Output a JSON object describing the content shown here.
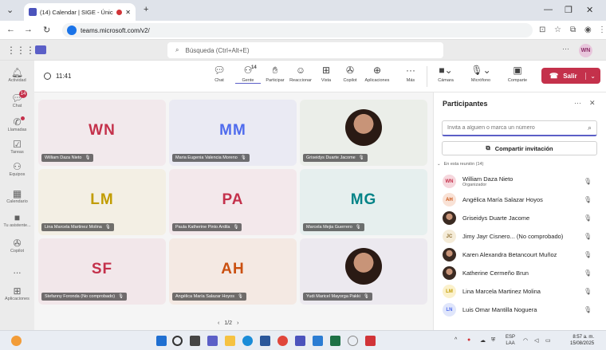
{
  "browser": {
    "tab_title": "(14) Calendar | SIGE - Únic...",
    "url": "teams.microsoft.com/v2/"
  },
  "teams": {
    "search_placeholder": "Búsqueda (Ctrl+Alt+E)",
    "me_initials": "WN"
  },
  "rail": [
    {
      "label": "Actividad",
      "icon": "bell-icon"
    },
    {
      "label": "Chat",
      "icon": "chat-icon",
      "badge": "14"
    },
    {
      "label": "Llamadas",
      "icon": "phone-icon"
    },
    {
      "label": "Tareas",
      "icon": "tasks-icon"
    },
    {
      "label": "Equipos",
      "icon": "teams-icon"
    },
    {
      "label": "Calendario",
      "icon": "calendar-icon"
    },
    {
      "label": "Tu asistente...",
      "icon": "assistant-icon"
    },
    {
      "label": "Copilot",
      "icon": "copilot-icon"
    },
    {
      "label": "...",
      "icon": "more-icon"
    },
    {
      "label": "Aplicaciones",
      "icon": "apps-icon"
    }
  ],
  "meeting": {
    "timer": "11:41",
    "people_count": "14",
    "toolbar": {
      "chat": "Chat",
      "people": "Gente",
      "raise": "Participar",
      "react": "Reaccionar",
      "view": "Vista",
      "copilot": "Copilot",
      "apps": "Aplicaciones",
      "more": "Más",
      "camera": "Cámara",
      "mic": "Micrófono",
      "share": "Comparte",
      "leave": "Salir"
    }
  },
  "tiles": [
    {
      "initials": "WN",
      "name": "William Daza Nieto",
      "color": "#c4314b",
      "bg": "#f2e9ec"
    },
    {
      "initials": "MM",
      "name": "Maria Eugenia Valencia Moreno",
      "color": "#4f6bed",
      "bg": "#eaeaf3"
    },
    {
      "initials": "",
      "name": "Griseidys Duarte Jacome",
      "color": "#000000",
      "bg": "#ebeee9"
    },
    {
      "initials": "LM",
      "name": "Lina Marcela Martinez Molina",
      "color": "#c19c00",
      "bg": "#f3efe4"
    },
    {
      "initials": "PA",
      "name": "Paula Katherine Pinto Ardila",
      "color": "#c4314b",
      "bg": "#f3e8eb"
    },
    {
      "initials": "MG",
      "name": "Marcela Mejia Guerrero",
      "color": "#038387",
      "bg": "#e6efee"
    },
    {
      "initials": "SF",
      "name": "Stefanny Foronda (No comprobado)",
      "color": "#c4314b",
      "bg": "#f2e7ea"
    },
    {
      "initials": "AH",
      "name": "Angélica María Salazar Hoyos",
      "color": "#ca5010",
      "bg": "#f4e9e3"
    },
    {
      "initials": "",
      "name": "Yudi Maricel Mayorga Pakki",
      "color": "#000000",
      "bg": "#ece9ef"
    }
  ],
  "pager": {
    "label": "1/2"
  },
  "panel": {
    "title": "Participantes",
    "invite_placeholder": "Invita a alguien o marca un número",
    "share_invite": "Compartir invitación",
    "section": "En esta reunión (14)",
    "people": [
      {
        "initials": "WN",
        "name": "William Daza Nieto",
        "role": "Organizador",
        "avatar_color": "#c4314b",
        "avatar_bg": "#f6d7dd"
      },
      {
        "initials": "AH",
        "name": "Angélica María Salazar Hoyos",
        "role": "",
        "avatar_color": "#ca5010",
        "avatar_bg": "#f9e2d6"
      },
      {
        "initials": "",
        "name": "Griseidys Duarte Jacome",
        "role": "",
        "avatar_color": "#000000",
        "avatar_bg": "#888888",
        "photo": true
      },
      {
        "initials": "JC",
        "name": "Jimy Jayr Cisnero... (No comprobado)",
        "role": "",
        "avatar_color": "#8f7034",
        "avatar_bg": "#f5ecd8"
      },
      {
        "initials": "",
        "name": "Karen Alexandra Betancourt Muñoz",
        "role": "",
        "avatar_color": "#000000",
        "avatar_bg": "#888888",
        "photo": true
      },
      {
        "initials": "",
        "name": "Katherine Cermeño Brun",
        "role": "",
        "avatar_color": "#000000",
        "avatar_bg": "#888888",
        "photo": true
      },
      {
        "initials": "LM",
        "name": "Lina Marcela Martinez Molina",
        "role": "",
        "avatar_color": "#c19c00",
        "avatar_bg": "#fbf1cc"
      },
      {
        "initials": "LN",
        "name": "Luis Omar Mantilla Noguera",
        "role": "",
        "avatar_color": "#4f6bed",
        "avatar_bg": "#e0e6fb"
      }
    ]
  },
  "taskbar": {
    "lang": "ESP",
    "lang2": "LAA",
    "time": "8:57 a. m.",
    "date": "15/08/2025"
  },
  "colors": {
    "accent": "#5b5fc7",
    "leave": "#c4314b"
  }
}
